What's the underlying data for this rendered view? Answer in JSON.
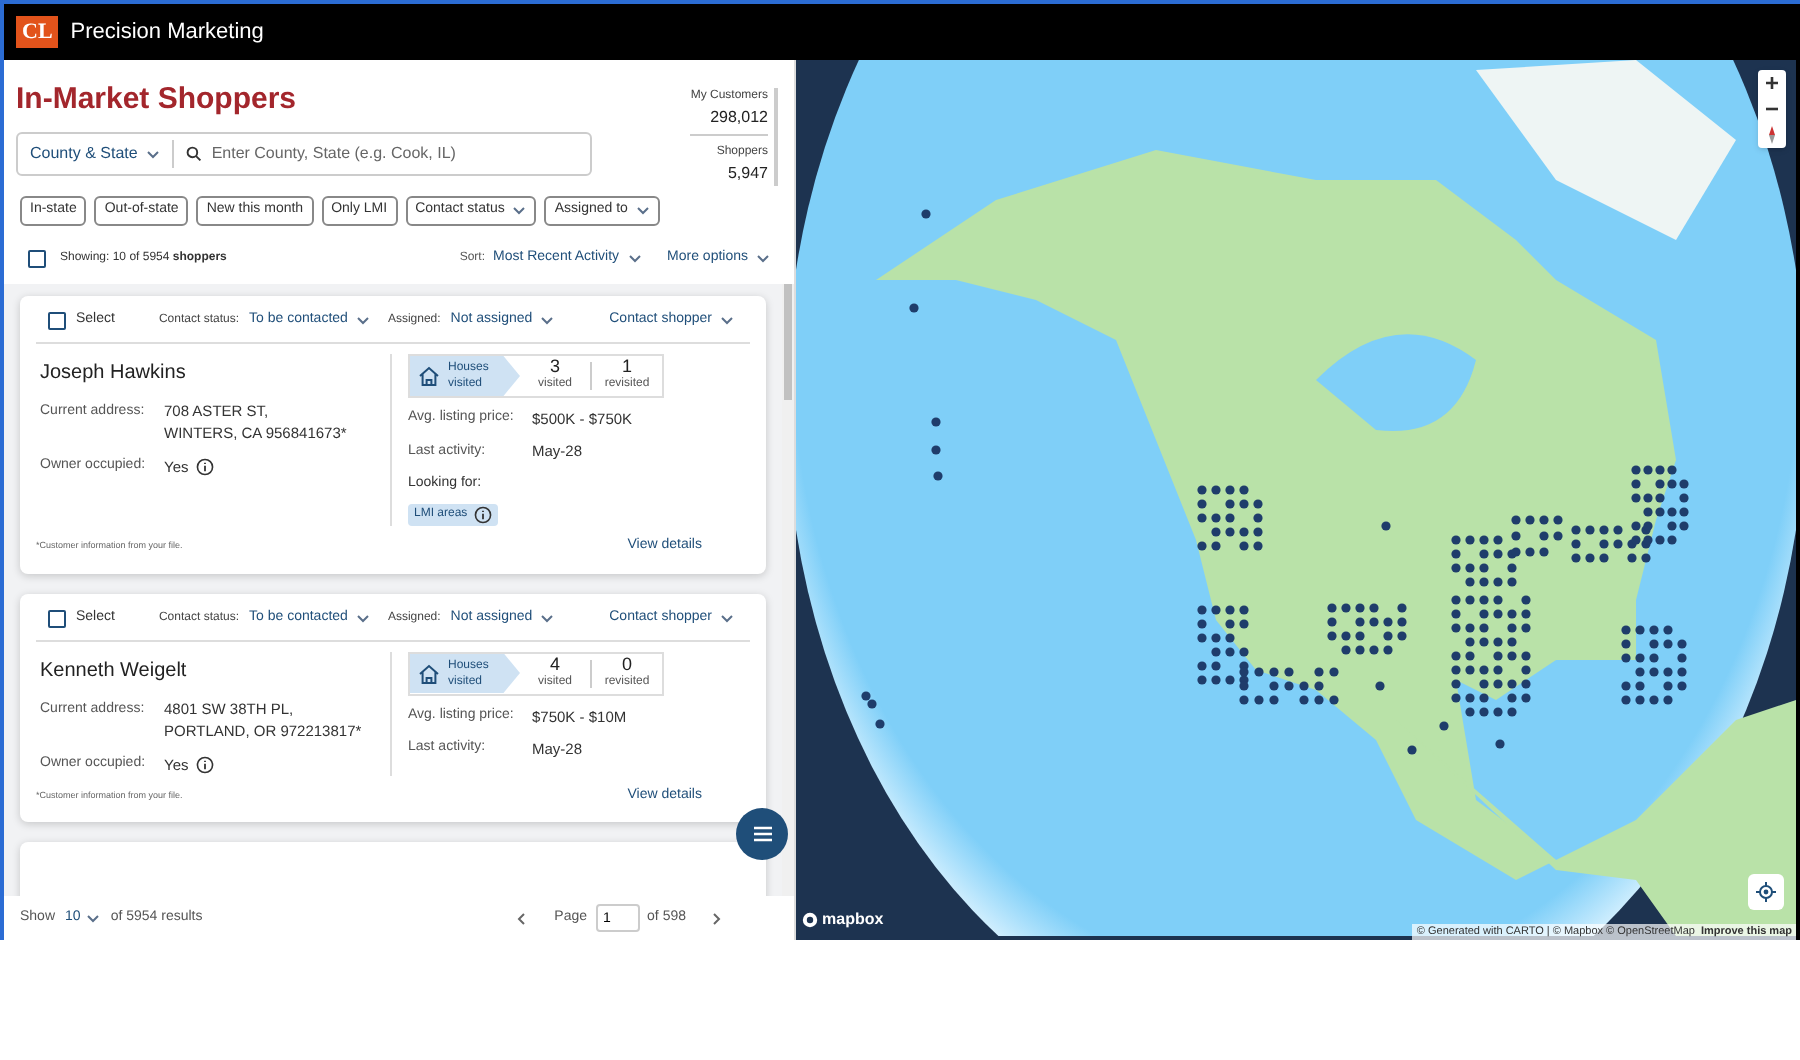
{
  "app": {
    "logo": "CL",
    "title": "Precision Marketing"
  },
  "page_title": "In-Market Shoppers",
  "stats": [
    {
      "label": "My Customers",
      "value": "298,012"
    },
    {
      "label": "Shoppers",
      "value": "5,947"
    }
  ],
  "search": {
    "scope": "County & State",
    "placeholder": "Enter County, State (e.g. Cook, IL)"
  },
  "filters": [
    {
      "label": "In-state",
      "dropdown": false
    },
    {
      "label": "Out-of-state",
      "dropdown": false
    },
    {
      "label": "New this month",
      "dropdown": false
    },
    {
      "label": "Only LMI",
      "dropdown": false
    },
    {
      "label": "Contact status",
      "dropdown": true
    },
    {
      "label": "Assigned to",
      "dropdown": true
    }
  ],
  "list_header": {
    "checked": false,
    "showing": "Showing: 10 of 5954 **shoppers**",
    "sort_label": "Sort:",
    "sort_value": "Most Recent Activity",
    "more": "More options"
  },
  "shoppers": [
    {
      "checked": false,
      "select_label": "Select",
      "contact_status_label": "Contact status:",
      "contact_status": "To be contacted",
      "assigned_label": "Assigned:",
      "assigned": "Not assigned",
      "action": "Contact shopper",
      "name": "Joseph Hawkins",
      "address_label": "Current address:",
      "address_lines": [
        "708 ASTER ST,",
        "WINTERS, CA 956841673*"
      ],
      "owner_label": "Owner occupied:",
      "owner": "Yes",
      "houses_label": "Houses visited",
      "visited": "3",
      "visited_label": "visited",
      "revisited": "1",
      "revisited_label": "revisited",
      "price_label": "Avg. listing price:",
      "price": "$500K - $750K",
      "activity_label": "Last activity:",
      "activity": "May-28",
      "looking_for_label": "Looking for:",
      "tags": [
        "LMI areas"
      ],
      "footnote": "*Customer information from your file.",
      "details": "View details"
    },
    {
      "checked": false,
      "select_label": "Select",
      "contact_status_label": "Contact status:",
      "contact_status": "To be contacted",
      "assigned_label": "Assigned:",
      "assigned": "Not assigned",
      "action": "Contact shopper",
      "name": "Kenneth Weigelt",
      "address_label": "Current address:",
      "address_lines": [
        "4801 SW 38TH PL,",
        "PORTLAND, OR 972213817*"
      ],
      "owner_label": "Owner occupied:",
      "owner": "Yes",
      "houses_label": "Houses visited",
      "visited": "4",
      "visited_label": "visited",
      "revisited": "0",
      "revisited_label": "revisited",
      "price_label": "Avg. listing price:",
      "price": "$750K - $10M",
      "activity_label": "Last activity:",
      "activity": "May-28",
      "footnote": "*Customer information from your file.",
      "details": "View details"
    }
  ],
  "pagination": {
    "show_label": "Show",
    "page_size": "10",
    "results": "of 5954 results",
    "page_label": "Page",
    "page": "1",
    "of_pages": "of 598"
  },
  "map": {
    "logo": "mapbox",
    "attribution": "© Generated with CARTO | © Mapbox © OpenStreetMap",
    "improve": "Improve this map"
  }
}
